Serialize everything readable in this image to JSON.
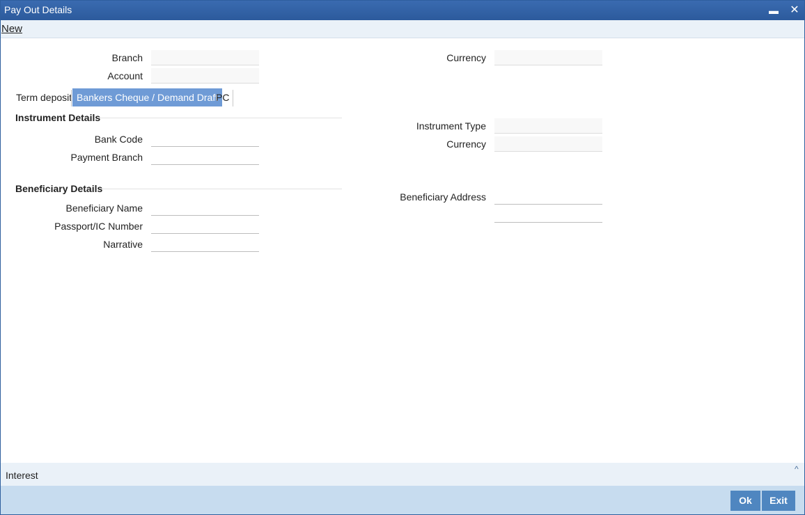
{
  "window": {
    "title": "Pay Out Details",
    "minimize_glyph": "▬",
    "close_glyph": "✕"
  },
  "menu": {
    "new_label": "New"
  },
  "header_fields": {
    "branch_label": "Branch",
    "account_label": "Account",
    "currency_label": "Currency",
    "branch_value": "",
    "account_value": "",
    "currency_value": ""
  },
  "tabs": [
    {
      "label": "Term deposit",
      "active": false
    },
    {
      "label": "Bankers Cheque / Demand Draft",
      "active": true
    },
    {
      "label": "PC",
      "active": false
    }
  ],
  "instrument": {
    "section_title": "Instrument Details",
    "bank_code_label": "Bank Code",
    "payment_branch_label": "Payment Branch",
    "instrument_type_label": "Instrument Type",
    "currency_label": "Currency",
    "bank_code_value": "",
    "payment_branch_value": "",
    "instrument_type_value": "",
    "currency_value": ""
  },
  "beneficiary": {
    "section_title": "Beneficiary Details",
    "name_label": "Beneficiary Name",
    "passport_label": "Passport/IC Number",
    "narrative_label": "Narrative",
    "address_label": "Beneficiary Address",
    "name_value": "",
    "passport_value": "",
    "narrative_value": "",
    "address_line1": "",
    "address_line2": ""
  },
  "footer": {
    "interest_label": "Interest",
    "expand_glyph": "^"
  },
  "actions": {
    "ok_label": "Ok",
    "exit_label": "Exit"
  },
  "colors": {
    "titlebar": "#2c5a9c",
    "active_tab": "#6f9bd6",
    "action_bar": "#c7dcef",
    "button": "#4f86c0"
  }
}
